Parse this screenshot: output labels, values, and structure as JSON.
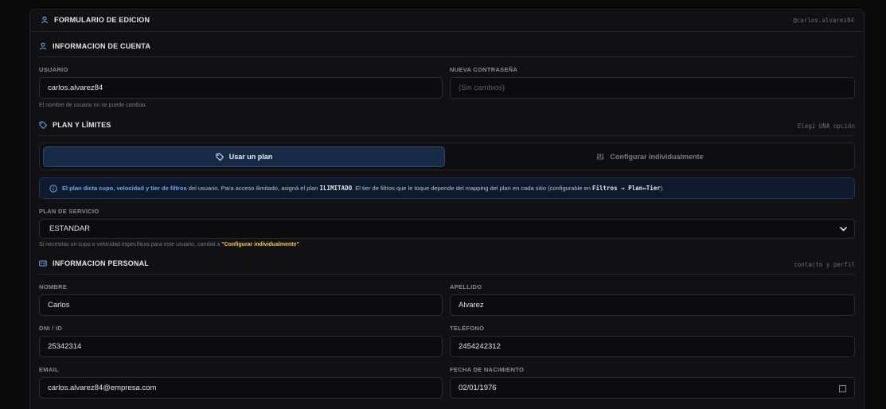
{
  "header": {
    "title": "FORMULARIO DE EDICION",
    "handle": "@carlos.alvarez84"
  },
  "account": {
    "title": "INFORMACION DE CUENTA",
    "username_label": "USUARIO",
    "username_value": "carlos.alvarez84",
    "username_hint": "El nombre de usuario no se puede cambiar.",
    "password_label": "NUEVA CONTRASEÑA",
    "password_placeholder": "(Sin cambios)"
  },
  "plan": {
    "title": "PLAN Y LÍMITES",
    "note": "Elegí UNA opción",
    "use_plan_label": "Usar un plan",
    "configure_label": "Configurar individualmente",
    "info": {
      "part1": "El plan dicta cupo, velocidad y tier de filtros",
      "part2": " del usuario. Para acceso ilimitado, asigná el plan ",
      "code1": "ILIMITADO",
      "part3": ". El tier de filtros que le toque depende del mapping del plan en cada sitio (configurable en ",
      "code2": "Filtros → Plan↔Tier",
      "part4": ")."
    },
    "service_label": "PLAN DE SERVICIO",
    "service_value": "ESTANDAR",
    "service_hint_prefix": "Si necesitás un cupo o velocidad específicos para este usuario, cambiá a ",
    "service_hint_link": "\"Configurar individualmente\"",
    "service_hint_suffix": "."
  },
  "personal": {
    "title": "INFORMACION PERSONAL",
    "note": "contacto y perfil",
    "first_name_label": "NOMBRE",
    "first_name_value": "Carlos",
    "last_name_label": "APELLIDO",
    "last_name_value": "Alvarez",
    "dni_label": "DNI / ID",
    "dni_value": "25342314",
    "phone_label": "TELÉFONO",
    "phone_value": "2454242312",
    "email_label": "EMAIL",
    "email_value": "carlos.alvarez84@empresa.com",
    "birth_label": "FECHA DE NACIMIENTO",
    "birth_value": "02/01/1976"
  },
  "colors": {
    "accent": "#6fa8f0",
    "highlight": "#f2c94c",
    "background": "#0a0a0b",
    "card": "#111113"
  }
}
